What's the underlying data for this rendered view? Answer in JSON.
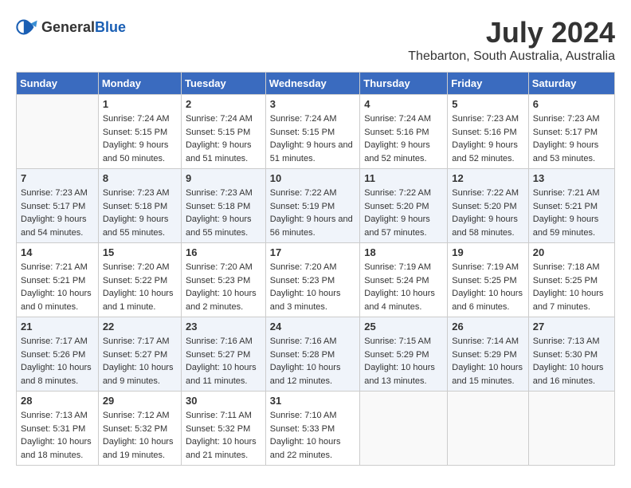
{
  "header": {
    "logo_general": "General",
    "logo_blue": "Blue",
    "month_year": "July 2024",
    "location": "Thebarton, South Australia, Australia"
  },
  "weekdays": [
    "Sunday",
    "Monday",
    "Tuesday",
    "Wednesday",
    "Thursday",
    "Friday",
    "Saturday"
  ],
  "weeks": [
    [
      {
        "day": "",
        "sunrise": "",
        "sunset": "",
        "daylight": ""
      },
      {
        "day": "1",
        "sunrise": "Sunrise: 7:24 AM",
        "sunset": "Sunset: 5:15 PM",
        "daylight": "Daylight: 9 hours and 50 minutes."
      },
      {
        "day": "2",
        "sunrise": "Sunrise: 7:24 AM",
        "sunset": "Sunset: 5:15 PM",
        "daylight": "Daylight: 9 hours and 51 minutes."
      },
      {
        "day": "3",
        "sunrise": "Sunrise: 7:24 AM",
        "sunset": "Sunset: 5:15 PM",
        "daylight": "Daylight: 9 hours and 51 minutes."
      },
      {
        "day": "4",
        "sunrise": "Sunrise: 7:24 AM",
        "sunset": "Sunset: 5:16 PM",
        "daylight": "Daylight: 9 hours and 52 minutes."
      },
      {
        "day": "5",
        "sunrise": "Sunrise: 7:23 AM",
        "sunset": "Sunset: 5:16 PM",
        "daylight": "Daylight: 9 hours and 52 minutes."
      },
      {
        "day": "6",
        "sunrise": "Sunrise: 7:23 AM",
        "sunset": "Sunset: 5:17 PM",
        "daylight": "Daylight: 9 hours and 53 minutes."
      }
    ],
    [
      {
        "day": "7",
        "sunrise": "Sunrise: 7:23 AM",
        "sunset": "Sunset: 5:17 PM",
        "daylight": "Daylight: 9 hours and 54 minutes."
      },
      {
        "day": "8",
        "sunrise": "Sunrise: 7:23 AM",
        "sunset": "Sunset: 5:18 PM",
        "daylight": "Daylight: 9 hours and 55 minutes."
      },
      {
        "day": "9",
        "sunrise": "Sunrise: 7:23 AM",
        "sunset": "Sunset: 5:18 PM",
        "daylight": "Daylight: 9 hours and 55 minutes."
      },
      {
        "day": "10",
        "sunrise": "Sunrise: 7:22 AM",
        "sunset": "Sunset: 5:19 PM",
        "daylight": "Daylight: 9 hours and 56 minutes."
      },
      {
        "day": "11",
        "sunrise": "Sunrise: 7:22 AM",
        "sunset": "Sunset: 5:20 PM",
        "daylight": "Daylight: 9 hours and 57 minutes."
      },
      {
        "day": "12",
        "sunrise": "Sunrise: 7:22 AM",
        "sunset": "Sunset: 5:20 PM",
        "daylight": "Daylight: 9 hours and 58 minutes."
      },
      {
        "day": "13",
        "sunrise": "Sunrise: 7:21 AM",
        "sunset": "Sunset: 5:21 PM",
        "daylight": "Daylight: 9 hours and 59 minutes."
      }
    ],
    [
      {
        "day": "14",
        "sunrise": "Sunrise: 7:21 AM",
        "sunset": "Sunset: 5:21 PM",
        "daylight": "Daylight: 10 hours and 0 minutes."
      },
      {
        "day": "15",
        "sunrise": "Sunrise: 7:20 AM",
        "sunset": "Sunset: 5:22 PM",
        "daylight": "Daylight: 10 hours and 1 minute."
      },
      {
        "day": "16",
        "sunrise": "Sunrise: 7:20 AM",
        "sunset": "Sunset: 5:23 PM",
        "daylight": "Daylight: 10 hours and 2 minutes."
      },
      {
        "day": "17",
        "sunrise": "Sunrise: 7:20 AM",
        "sunset": "Sunset: 5:23 PM",
        "daylight": "Daylight: 10 hours and 3 minutes."
      },
      {
        "day": "18",
        "sunrise": "Sunrise: 7:19 AM",
        "sunset": "Sunset: 5:24 PM",
        "daylight": "Daylight: 10 hours and 4 minutes."
      },
      {
        "day": "19",
        "sunrise": "Sunrise: 7:19 AM",
        "sunset": "Sunset: 5:25 PM",
        "daylight": "Daylight: 10 hours and 6 minutes."
      },
      {
        "day": "20",
        "sunrise": "Sunrise: 7:18 AM",
        "sunset": "Sunset: 5:25 PM",
        "daylight": "Daylight: 10 hours and 7 minutes."
      }
    ],
    [
      {
        "day": "21",
        "sunrise": "Sunrise: 7:17 AM",
        "sunset": "Sunset: 5:26 PM",
        "daylight": "Daylight: 10 hours and 8 minutes."
      },
      {
        "day": "22",
        "sunrise": "Sunrise: 7:17 AM",
        "sunset": "Sunset: 5:27 PM",
        "daylight": "Daylight: 10 hours and 9 minutes."
      },
      {
        "day": "23",
        "sunrise": "Sunrise: 7:16 AM",
        "sunset": "Sunset: 5:27 PM",
        "daylight": "Daylight: 10 hours and 11 minutes."
      },
      {
        "day": "24",
        "sunrise": "Sunrise: 7:16 AM",
        "sunset": "Sunset: 5:28 PM",
        "daylight": "Daylight: 10 hours and 12 minutes."
      },
      {
        "day": "25",
        "sunrise": "Sunrise: 7:15 AM",
        "sunset": "Sunset: 5:29 PM",
        "daylight": "Daylight: 10 hours and 13 minutes."
      },
      {
        "day": "26",
        "sunrise": "Sunrise: 7:14 AM",
        "sunset": "Sunset: 5:29 PM",
        "daylight": "Daylight: 10 hours and 15 minutes."
      },
      {
        "day": "27",
        "sunrise": "Sunrise: 7:13 AM",
        "sunset": "Sunset: 5:30 PM",
        "daylight": "Daylight: 10 hours and 16 minutes."
      }
    ],
    [
      {
        "day": "28",
        "sunrise": "Sunrise: 7:13 AM",
        "sunset": "Sunset: 5:31 PM",
        "daylight": "Daylight: 10 hours and 18 minutes."
      },
      {
        "day": "29",
        "sunrise": "Sunrise: 7:12 AM",
        "sunset": "Sunset: 5:32 PM",
        "daylight": "Daylight: 10 hours and 19 minutes."
      },
      {
        "day": "30",
        "sunrise": "Sunrise: 7:11 AM",
        "sunset": "Sunset: 5:32 PM",
        "daylight": "Daylight: 10 hours and 21 minutes."
      },
      {
        "day": "31",
        "sunrise": "Sunrise: 7:10 AM",
        "sunset": "Sunset: 5:33 PM",
        "daylight": "Daylight: 10 hours and 22 minutes."
      },
      {
        "day": "",
        "sunrise": "",
        "sunset": "",
        "daylight": ""
      },
      {
        "day": "",
        "sunrise": "",
        "sunset": "",
        "daylight": ""
      },
      {
        "day": "",
        "sunrise": "",
        "sunset": "",
        "daylight": ""
      }
    ]
  ]
}
